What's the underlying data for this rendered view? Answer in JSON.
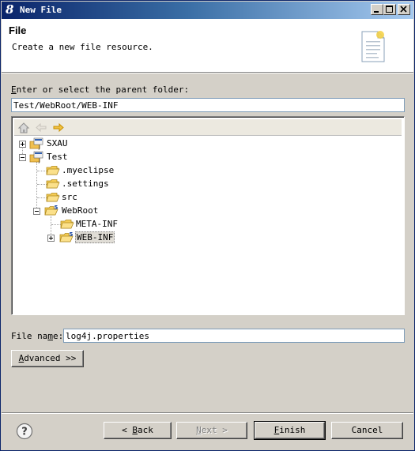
{
  "window": {
    "title": "New File",
    "controls": {
      "minimize": "minimize",
      "maximize": "maximize",
      "close": "close"
    }
  },
  "banner": {
    "title": "File",
    "description": "Create a new file resource.",
    "icon": "new-file-wizard-icon"
  },
  "parent_folder": {
    "label_first": "E",
    "label_rest": "nter or select the parent folder:",
    "value": "Test/WebRoot/WEB-INF"
  },
  "tree": {
    "nav": {
      "home": "home-icon",
      "back": "back-arrow-icon",
      "forward": "forward-arrow-icon"
    },
    "items": [
      {
        "label": "SXAU",
        "icon": "project-icon",
        "expander": "plus",
        "depth": 0
      },
      {
        "label": "Test",
        "icon": "project-icon",
        "expander": "minus",
        "depth": 0
      },
      {
        "label": ".myeclipse",
        "icon": "folder-icon",
        "expander": "none",
        "depth": 1
      },
      {
        "label": ".settings",
        "icon": "folder-icon",
        "expander": "none",
        "depth": 1
      },
      {
        "label": "src",
        "icon": "folder-icon",
        "expander": "none",
        "depth": 1
      },
      {
        "label": "WebRoot",
        "icon": "web-folder-icon",
        "expander": "minus",
        "depth": 1
      },
      {
        "label": "META-INF",
        "icon": "folder-icon",
        "expander": "none",
        "depth": 2
      },
      {
        "label": "WEB-INF",
        "icon": "web-folder-icon",
        "expander": "plus",
        "depth": 2,
        "selected": true
      }
    ]
  },
  "file_name": {
    "label_before": "File na",
    "label_underlined": "m",
    "label_after": "e:",
    "value": "log4j.properties"
  },
  "advanced": {
    "label_underlined": "A",
    "label_rest": "dvanced >>"
  },
  "footer": {
    "help": "help-icon",
    "back": {
      "prefix": "< ",
      "underlined": "B",
      "rest": "ack"
    },
    "next": {
      "underlined": "N",
      "rest": "ext >"
    },
    "finish": {
      "underlined": "F",
      "rest": "inish"
    },
    "cancel": "Cancel"
  },
  "colors": {
    "titlebar_start": "#0a246a",
    "titlebar_end": "#a6caf0",
    "dialog_bg": "#d4d0c8",
    "folder": "#f0c050"
  }
}
